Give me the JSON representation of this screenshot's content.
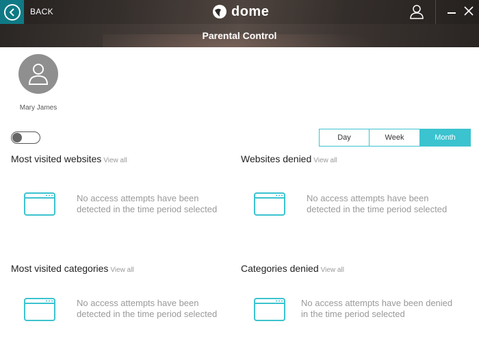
{
  "header": {
    "back_label": "BACK",
    "logo_text": "dome",
    "page_title": "Parental Control"
  },
  "profile": {
    "name": "Mary James"
  },
  "toggle": {
    "enabled": false
  },
  "period_tabs": [
    {
      "label": "Day",
      "active": false
    },
    {
      "label": "Week",
      "active": false
    },
    {
      "label": "Month",
      "active": true
    }
  ],
  "sections": {
    "most_visited_websites": {
      "title": "Most visited websites",
      "view_all": "View all",
      "message_line1": "No access attempts have been",
      "message_line2": "detected in the time period selected"
    },
    "websites_denied": {
      "title": "Websites denied",
      "view_all": "View all",
      "message_line1": "No access attempts have been",
      "message_line2": "detected in the time period selected"
    },
    "most_visited_categories": {
      "title": "Most visited categories",
      "view_all": "View all",
      "message_line1": "No access attempts have been",
      "message_line2": "detected in the time period selected"
    },
    "categories_denied": {
      "title": "Categories denied",
      "view_all": "View all",
      "message_line1": "No access attempts have been denied",
      "message_line2": "in the time period selected"
    }
  },
  "colors": {
    "accent": "#3bc3cf",
    "back_button": "#0f7a85",
    "header_dark": "#2a2623"
  },
  "icons": {
    "back": "chevron-left-circle-icon",
    "logo": "dome-logo-icon",
    "user": "user-icon",
    "minimize": "minimize-icon",
    "close": "close-icon",
    "avatar": "person-icon",
    "browser": "browser-window-icon"
  }
}
